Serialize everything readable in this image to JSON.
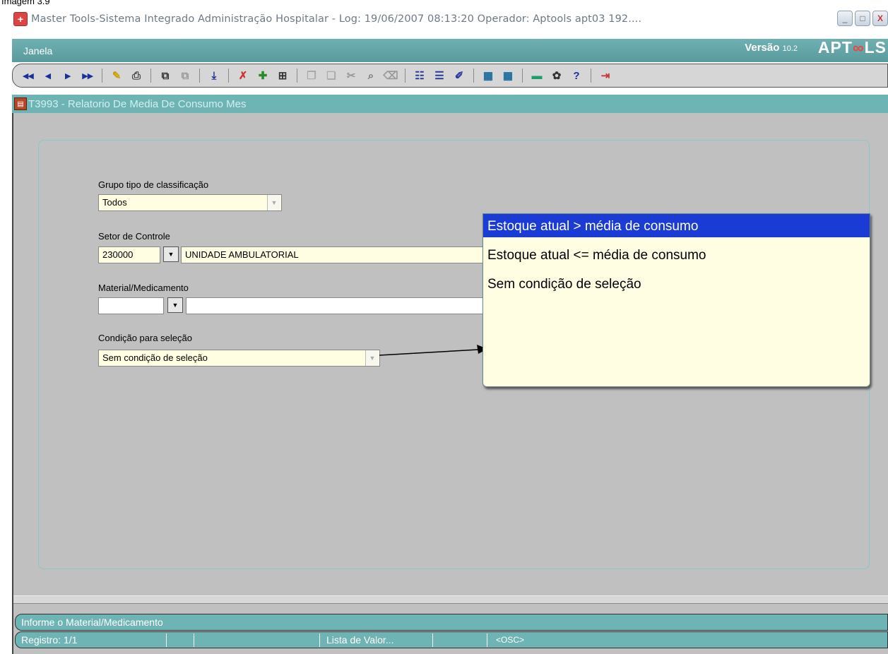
{
  "caption": "Imagem 3.9",
  "window": {
    "title": "Master Tools-Sistema Integrado Administração Hospitalar - Log: 19/06/2007 08:13:20 Operador: Aptools apt03 192....",
    "minimize": "_",
    "maximize": "□",
    "close": "X"
  },
  "menu": {
    "janela": "Janela",
    "version_label": "Versão",
    "version_number": "10.2",
    "brand_a": "APT",
    "brand_b": "LS"
  },
  "form_title": "T3993 - Relatorio De Media De Consumo Mes",
  "fields": {
    "grupo": {
      "label": "Grupo tipo de classificação",
      "value": "Todos"
    },
    "setor": {
      "label": "Setor de Controle",
      "code": "230000",
      "name": "UNIDADE AMBULATORIAL"
    },
    "material": {
      "label": "Material/Medicamento",
      "code": "",
      "name": ""
    },
    "condicao": {
      "label": "Condição para seleção",
      "value": "Sem condição de seleção"
    }
  },
  "popup_options": [
    "Estoque atual > média de consumo",
    "Estoque atual <= média de consumo",
    "Sem condição de seleção"
  ],
  "popup_selected_index": 0,
  "hint": "Informe o Material/Medicamento",
  "status": {
    "registro": "Registro: 1/1",
    "lista": "Lista de Valor...",
    "osc": "<OSC>"
  },
  "colors": {
    "teal": "#6fb4b4",
    "selection": "#1a3bd4",
    "field_bg": "#fffde2"
  }
}
